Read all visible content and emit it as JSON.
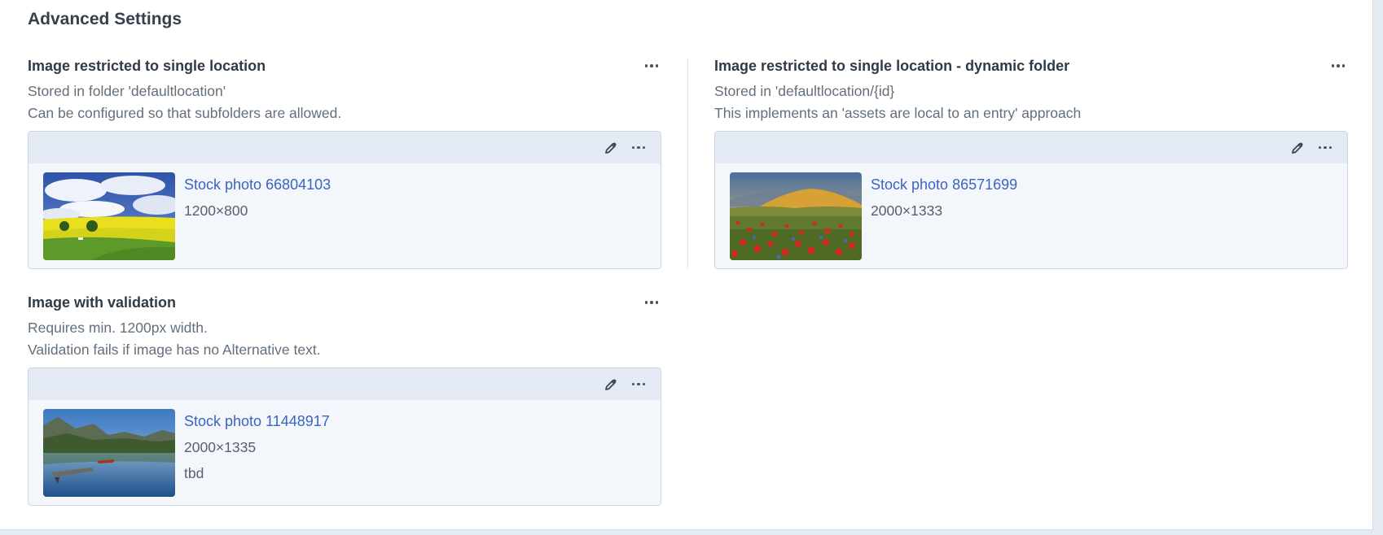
{
  "section": {
    "title": "Advanced Settings"
  },
  "fields": [
    {
      "label": "Image restricted to single location",
      "instructions": [
        "Stored in folder 'defaultlocation'",
        "Can be configured so that subfolders are allowed."
      ],
      "asset": {
        "title": "Stock photo 66804103",
        "dimensions": "1200×800",
        "thumbnail": "canola-field-sky-thumbnail"
      }
    },
    {
      "label": "Image restricted to single location - dynamic folder",
      "instructions": [
        "Stored in 'defaultlocation/{id}",
        "This implements an 'assets are local to an entry' approach"
      ],
      "asset": {
        "title": "Stock photo 86571699",
        "dimensions": "2000×1333",
        "thumbnail": "poppy-field-mountain-thumbnail"
      }
    },
    {
      "label": "Image with validation",
      "instructions": [
        "Requires min. 1200px width.",
        "Validation fails if image has no Alternative text."
      ],
      "asset": {
        "title": "Stock photo 11448917",
        "dimensions": "2000×1335",
        "note": "tbd",
        "thumbnail": "lake-dock-mountains-thumbnail"
      }
    }
  ],
  "icons": {
    "field_menu": "ellipsis-icon",
    "edit": "pencil-icon",
    "asset_menu": "ellipsis-icon"
  },
  "colors": {
    "link": "#3b64c1",
    "card_bg": "#f3f6fa",
    "toolbar_bg": "#e3eaf3",
    "page_bg": "#e4eaf2"
  }
}
